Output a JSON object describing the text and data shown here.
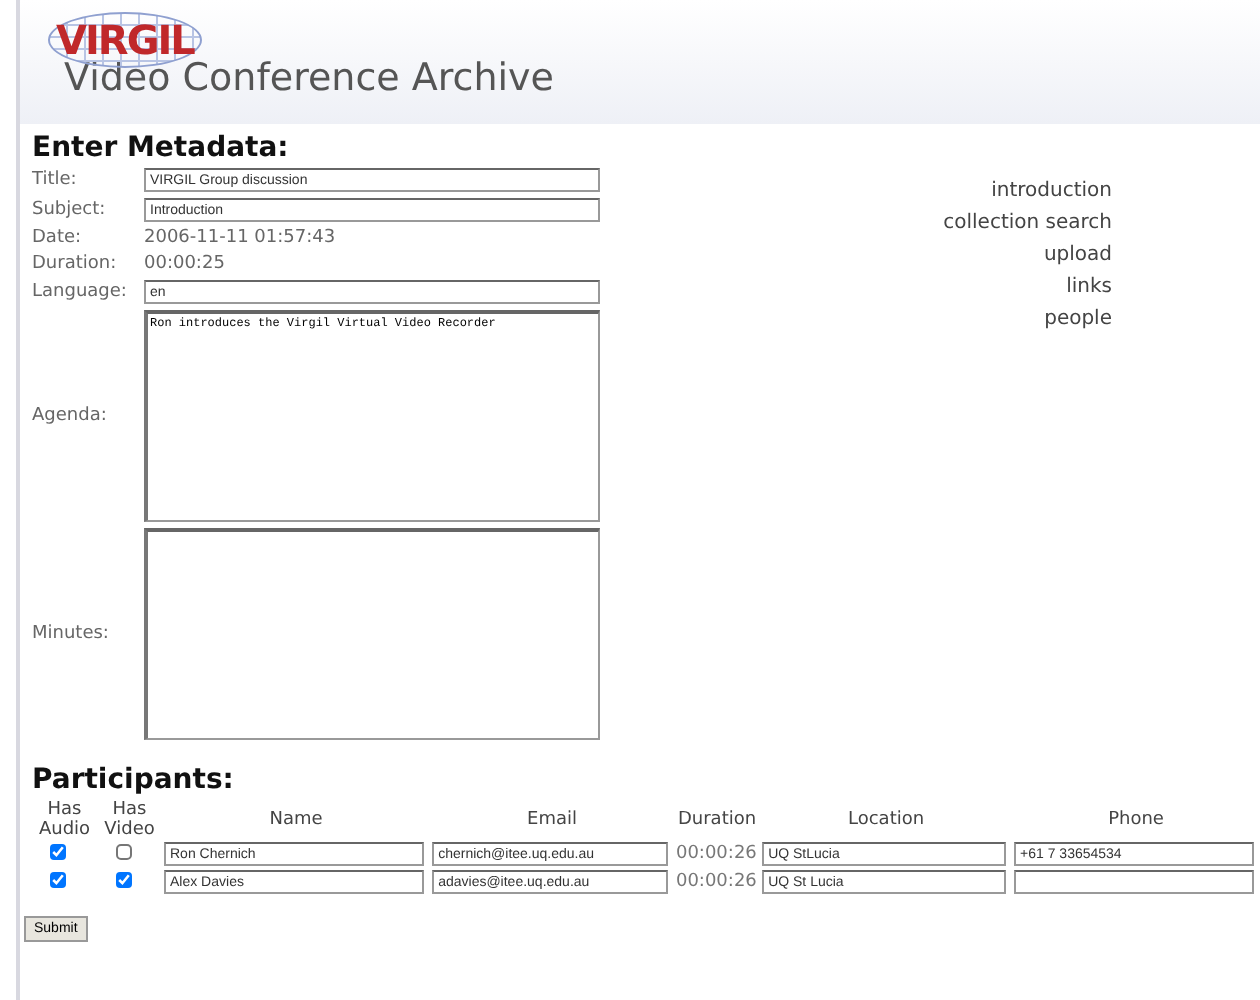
{
  "logo": "VIRGIL",
  "title": "Video Conference Archive",
  "metadata_heading": "Enter Metadata:",
  "fields": [
    {
      "kind": "input",
      "label": "Title:",
      "value": "VIRGIL Group discussion"
    },
    {
      "kind": "input",
      "label": "Subject:",
      "value": "Introduction"
    },
    {
      "kind": "text",
      "label": "Date:",
      "value": "2006-11-11 01:57:43"
    },
    {
      "kind": "text",
      "label": "Duration:",
      "value": "00:00:25"
    },
    {
      "kind": "input",
      "label": "Language:",
      "value": "en"
    },
    {
      "kind": "textarea",
      "label": "Agenda:",
      "value": "Ron introduces the Virgil Virtual Video Recorder"
    },
    {
      "kind": "textarea",
      "label": "Minutes:"
    }
  ],
  "nav": [
    "introduction",
    "collection search",
    "upload",
    "links",
    "people"
  ],
  "participants_heading": "Participants:",
  "columns": [
    "Has Audio",
    "Has Video",
    "Name",
    "Email",
    "Duration",
    "Location",
    "Phone"
  ],
  "participants": [
    {
      "audio": true,
      "video": false,
      "name": "Ron Chernich",
      "email": "chernich@itee.uq.edu.au",
      "duration": "00:00:26",
      "location": "UQ StLucia",
      "phone": "+61 7 33654534"
    },
    {
      "audio": true,
      "video": true,
      "name": "Alex Davies",
      "email": "adavies@itee.uq.edu.au",
      "duration": "00:00:26",
      "location": "UQ St Lucia"
    }
  ],
  "submit": "Submit"
}
